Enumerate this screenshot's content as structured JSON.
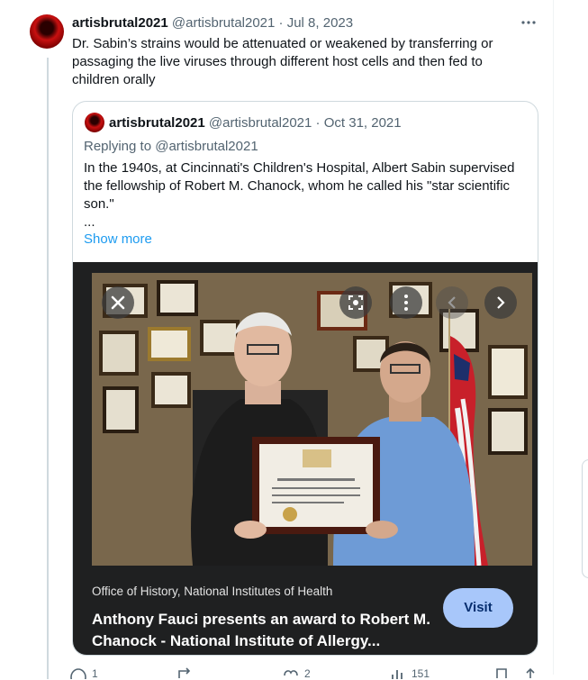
{
  "tweet": {
    "name": "artisbrutal2021",
    "handle": "@artisbrutal2021",
    "dot": "·",
    "date": "Jul 8, 2023",
    "more_icon": "more-icon",
    "text": "Dr. Sabin’s strains would be attenuated or weakened by transferring or passaging the live viruses through different host cells and then fed to children orally"
  },
  "quote": {
    "name": "artisbrutal2021",
    "handle": "@artisbrutal2021",
    "dot": "·",
    "date": "Oct 31, 2021",
    "replying_to": "Replying to @artisbrutal2021",
    "text": "In the 1940s, at Cincinnati's Children's Hospital, Albert Sabin supervised the fellowship of Robert M. Chanock, whom he called his \"star scientific son.\"\n...",
    "show_more": "Show more"
  },
  "card": {
    "source": "Office of History, National Institutes of Health",
    "title": "Anthony Fauci presents an award to Robert M. Chanock - National Institute of Allergy...",
    "visit_label": "Visit",
    "controls": [
      "close-icon",
      "lens-icon",
      "more-vert-icon",
      "chevron-left-icon",
      "chevron-right-icon"
    ]
  },
  "actions": {
    "reply_count": "1",
    "retweet_count": "",
    "like_count": "2",
    "views_count": "151"
  },
  "colors": {
    "accent": "#1d9bf0",
    "border": "#cfd9de",
    "muted": "#536471",
    "card_bg": "#1f2021",
    "visit_bg": "#a8c7fa"
  }
}
